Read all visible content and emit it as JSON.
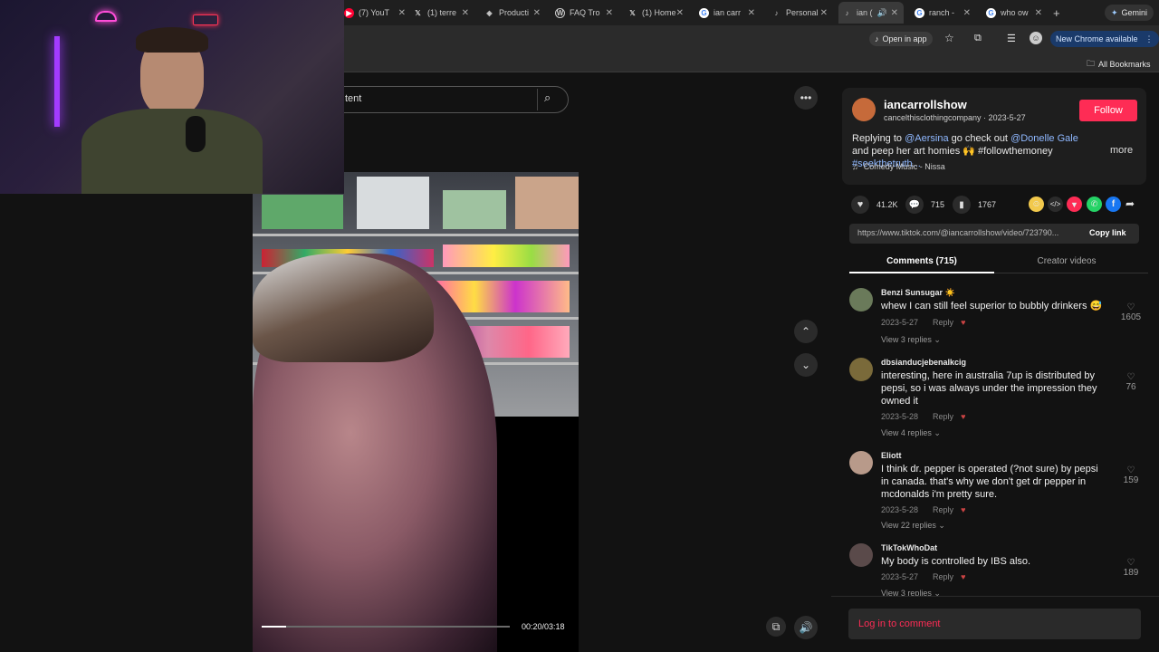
{
  "browser": {
    "tabs": [
      {
        "label": "(7) YouT",
        "icon": "youtube-icon",
        "color": "#ff0033"
      },
      {
        "label": "(1) terre",
        "icon": "x-icon",
        "color": "#ffffff"
      },
      {
        "label": "Producti",
        "icon": "product-icon",
        "color": "#ffffff"
      },
      {
        "label": "FAQ Tro",
        "icon": "wordpress-icon",
        "color": "#ffffff"
      },
      {
        "label": "(1) Home",
        "icon": "x-icon",
        "color": "#ffffff"
      },
      {
        "label": "ian carr",
        "icon": "google-icon",
        "color": "#4285f4"
      },
      {
        "label": "Personal",
        "icon": "tiktok-icon",
        "color": "#ffffff"
      },
      {
        "label": "ian (",
        "icon": "tiktok-icon",
        "color": "#ffffff"
      },
      {
        "label": "ranch -",
        "icon": "google-icon",
        "color": "#4285f4"
      },
      {
        "label": "who ow",
        "icon": "google-icon",
        "color": "#4285f4"
      }
    ],
    "new_tab": "+",
    "gemini_label": "Gemini",
    "open_in_app": "Open in app",
    "update_label": "New Chrome available",
    "all_bookmarks": "All Bookmarks"
  },
  "video": {
    "search_placeholder": "tent",
    "time": "00:20/03:18",
    "progress": 0.1
  },
  "post": {
    "username": "iancarrollshow",
    "subline": "cancelthisclothingcompany · 2023-5-27",
    "follow_label": "Follow",
    "caption_prefix": "Replying to ",
    "mention1": "@Aersina",
    "caption_mid": " go check out ",
    "mention2": "@Donelle Gale",
    "caption_rest": " and peep her art homies 🙌 #followthemoney ",
    "hashtag": "#seekthetruth...",
    "more_label": "more",
    "music": "Comedy Music - Nissa",
    "likes": "41.2K",
    "comments_count": "715",
    "saves": "1767",
    "url": "https://www.tiktok.com/@iancarrollshow/video/723790...",
    "copy_link": "Copy link",
    "tab_comments": "Comments (715)",
    "tab_creator": "Creator videos",
    "login_label": "Log in to comment"
  },
  "comments": [
    {
      "name": "Benzi Sunsugar ☀️",
      "text": "whew I can still feel superior to bubbly drinkers 😅",
      "date": "2023-5-27",
      "reply": "Reply",
      "replies": "View 3 replies",
      "likes": "1605",
      "avatar_color": "#6a7a5a"
    },
    {
      "name": "dbsianducjebenalkcig",
      "text": "interesting, here in australia 7up is distributed by pepsi, so i was always under the impression they owned it",
      "date": "2023-5-28",
      "reply": "Reply",
      "replies": "View 4 replies",
      "likes": "76",
      "avatar_color": "#7a6a3a"
    },
    {
      "name": "Eliott",
      "text": "I think dr. pepper is operated (?not sure) by pepsi in canada. that's why we don't get dr pepper in mcdonalds i'm pretty sure.",
      "date": "2023-5-28",
      "reply": "Reply",
      "replies": "View 22 replies",
      "likes": "159",
      "avatar_color": "#b89a8a"
    },
    {
      "name": "TikTokWhoDat",
      "text": "My body is controlled by IBS also.",
      "date": "2023-5-27",
      "reply": "Reply",
      "replies": "View 3 replies",
      "likes": "189",
      "avatar_color": "#5a4a4a"
    }
  ],
  "colors": {
    "follow_bg": "#fe2c55",
    "accent_link": "#8fb8ff",
    "update_pill": "#1a3a6a"
  }
}
